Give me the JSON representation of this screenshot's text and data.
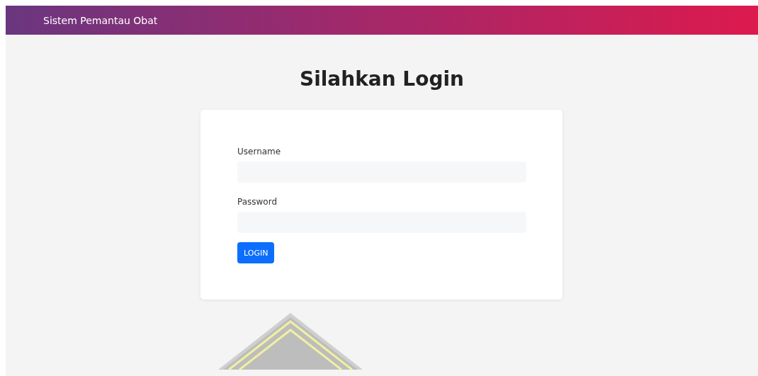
{
  "navbar": {
    "brand": "Sistem Pemantau Obat"
  },
  "heading": "Silahkan Login",
  "form": {
    "fields": [
      {
        "label": "Username"
      },
      {
        "label": "Password"
      }
    ],
    "button": "LOGIN"
  }
}
